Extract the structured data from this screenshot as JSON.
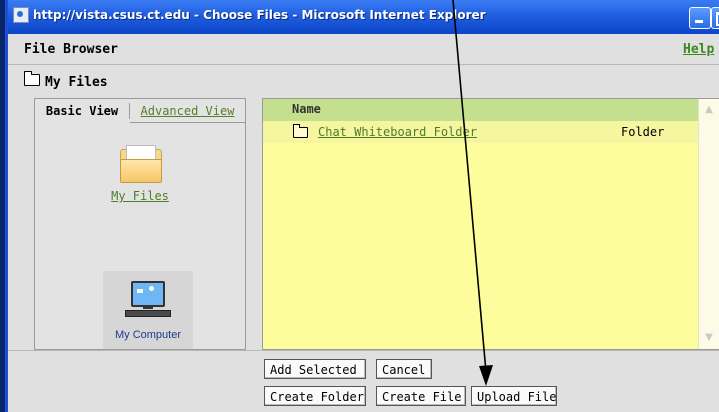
{
  "window": {
    "title": "http://vista.csus.ct.edu - Choose Files - Microsoft Internet Explorer"
  },
  "header": {
    "title": "File Browser",
    "help_label": "Help"
  },
  "location": {
    "label": "My Files"
  },
  "left_panel": {
    "tabs": [
      {
        "label": "Basic View",
        "active": true
      },
      {
        "label": "Advanced View",
        "active": false
      }
    ],
    "items": [
      {
        "label": "My Files",
        "icon": "folder-icon"
      },
      {
        "label": "My Computer",
        "icon": "computer-icon"
      }
    ]
  },
  "file_list": {
    "columns": [
      "Name"
    ],
    "rows": [
      {
        "name": "Chat Whiteboard Folder",
        "type": "Folder",
        "icon": "folder-icon"
      }
    ]
  },
  "buttons": {
    "add_selected": "Add Selected",
    "cancel": "Cancel",
    "create_folder": "Create Folder",
    "create_file": "Create File",
    "upload_file": "Upload File"
  },
  "colors": {
    "titlebar": "#1f5fe0",
    "list_background": "#fdfd9e",
    "list_header": "#c4e08f",
    "link": "#4e7d2a"
  }
}
